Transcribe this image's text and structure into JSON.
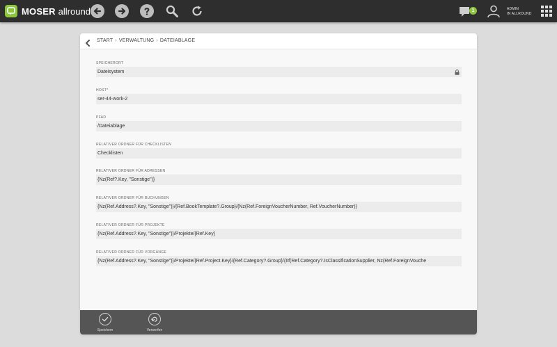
{
  "header": {
    "brand_bold": "MOSER",
    "brand_rest": "allround",
    "chat_badge": "1",
    "user_line1": "ADMIN",
    "user_line2": "IN ALLROUND"
  },
  "breadcrumb": [
    "START",
    "VERWALTUNG",
    "DATEIABLAGE"
  ],
  "breadcrumb_separator": "›",
  "fields": [
    {
      "label": "SPEICHERORT",
      "value": "Dateisystem",
      "locked": true
    },
    {
      "label": "HOST*",
      "value": "ser-44-work-2"
    },
    {
      "label": "PFAD",
      "value": "/Dateiablage"
    },
    {
      "label": "RELATIVER ORDNER FÜR CHECKLISTEN",
      "value": "Checklisten"
    },
    {
      "label": "RELATIVER ORDNER FÜR ADRESSEN",
      "value": "{Nz(Ref?.Key, \"Sonstige\")}"
    },
    {
      "label": "RELATIVER ORDNER FÜR BUCHUNGEN",
      "value": "{Nz(Ref.Address?.Key, \"Sonstige\")}/{Ref.BookTemplate?.Group}/{Nz(Ref.ForeignVoucherNumber, Ref.VoucherNumber)}"
    },
    {
      "label": "RELATIVER ORDNER FÜR PROJEKTE",
      "value": "{Nz(Ref.Address?.Key, \"Sonstige\")}/Projekte/{Ref.Key}"
    },
    {
      "label": "RELATIVER ORDNER FÜR VORGÄNGE",
      "value": "{Nz(Ref.Address?.Key, \"Sonstige\")}/Projekte/{Ref.Project.Key}/{Ref.Category?.Group}/{IIf(Ref.Category?.IsClassificationSupplier, Nz(Ref.ForeignVouche"
    }
  ],
  "actions": {
    "save_label": "Speichern",
    "discard_label": "Verwerfen"
  },
  "colors": {
    "topbar": "#2e2e2e",
    "accent": "#8cc63f",
    "actionbar": "#555555"
  },
  "icons": [
    "logo-icon",
    "back-arrow-icon",
    "forward-arrow-icon",
    "help-icon",
    "search-icon",
    "refresh-icon",
    "chat-icon",
    "user-icon",
    "apps-grid-icon",
    "chevron-left-icon",
    "lock-icon",
    "checkmark-icon",
    "undo-icon"
  ]
}
